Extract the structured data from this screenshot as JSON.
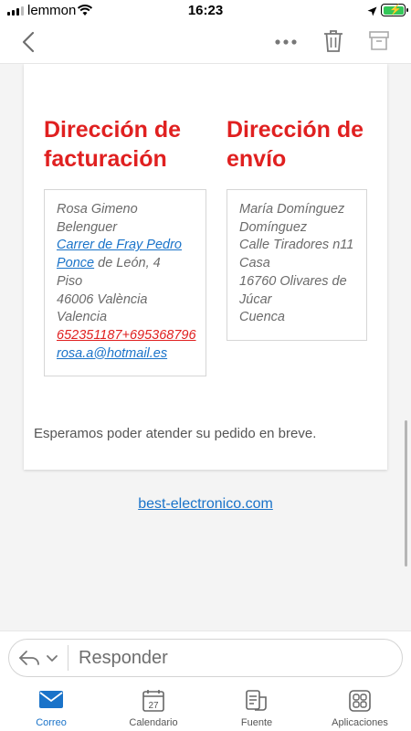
{
  "status": {
    "carrier": "lemmon",
    "time": "16:23"
  },
  "nav": {
    "back_icon": "chevron-left-icon",
    "more_icon": "more-horizontal-icon",
    "delete_icon": "trash-icon",
    "archive_icon": "archive-icon"
  },
  "billing": {
    "title_line1": "Dirección de",
    "title_line2": "facturación",
    "name_line1": "Rosa Gimeno",
    "name_line2": "Belenguer",
    "street_link_line1": "Carrer de Fray Pedro",
    "street_link_line2": "Ponce",
    "street_rest": " de León, 4",
    "floor": "Piso",
    "postcode_city": "46006 València",
    "province": "Valencia",
    "phone": "652351187+695368796",
    "email": "rosa.a@hotmail.es"
  },
  "shipping": {
    "title_line1": "Dirección de",
    "title_line2": "envío",
    "name_line1": "María Domínguez",
    "name_line2": "Domínguez",
    "street": "Calle Tiradores n11",
    "detail": "Casa",
    "postcode_city_line1": "16760 Olivares de",
    "postcode_city_line2": "Júcar",
    "province": "Cuenca"
  },
  "closing_text": "Esperamos poder atender su pedido en breve.",
  "footer_link": "best-electronico.com",
  "reply": {
    "placeholder": "Responder",
    "reply_icon": "reply-icon",
    "options_icon": "chevron-down-icon"
  },
  "tabs": [
    {
      "label": "Correo",
      "icon": "mail-icon",
      "active": true
    },
    {
      "label": "Calendario",
      "icon": "calendar-icon",
      "day": "27"
    },
    {
      "label": "Fuente",
      "icon": "feed-icon"
    },
    {
      "label": "Aplicaciones",
      "icon": "apps-icon"
    }
  ],
  "colors": {
    "accent": "#1a73c9",
    "heading_red": "#e02020",
    "battery_green": "#34c759"
  }
}
